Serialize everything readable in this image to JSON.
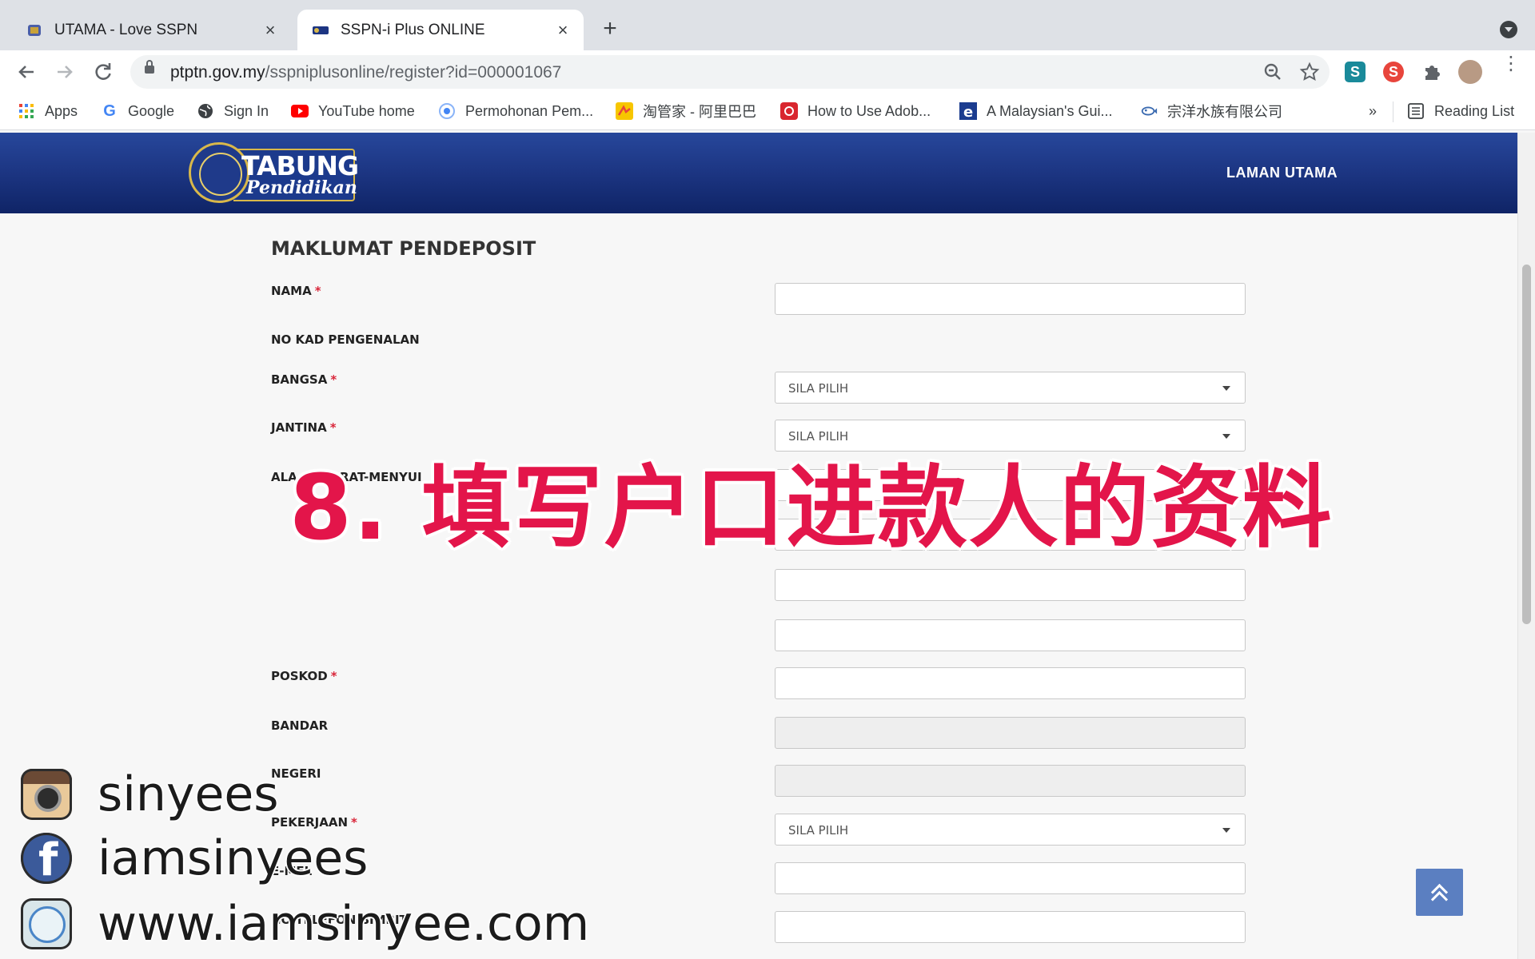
{
  "browser": {
    "tabs": [
      {
        "title": "UTAMA - Love SSPN",
        "active": false
      },
      {
        "title": "SSPN-i Plus ONLINE",
        "active": true
      }
    ],
    "new_tab_label": "+",
    "close_label": "×",
    "url_domain": "ptptn.gov.my",
    "url_path": "/sspniplusonline/register?id=000001067",
    "bookmarks": [
      {
        "label": "Apps"
      },
      {
        "label": "Google"
      },
      {
        "label": "Sign In"
      },
      {
        "label": "YouTube home"
      },
      {
        "label": "Permohonan Pem..."
      },
      {
        "label": "淘管家 - 阿里巴巴"
      },
      {
        "label": "How to Use Adob..."
      },
      {
        "label": "A Malaysian's Gui..."
      },
      {
        "label": "宗洋水族有限公司"
      }
    ],
    "bookmarks_more": "»",
    "reading_list": "Reading List",
    "extensions": [
      {
        "name": "s-extension",
        "letter": "S",
        "color": "#1a8a9a"
      },
      {
        "name": "s-red-extension",
        "letter": "S",
        "color": "#e8453c"
      }
    ]
  },
  "site": {
    "logo_word1": "TABUNG",
    "logo_word2": "Pendidikan",
    "nav_home": "LAMAN UTAMA"
  },
  "form": {
    "section_title": "MAKLUMAT PENDEPOSIT",
    "required_mark": "*",
    "labels": {
      "nama": "NAMA",
      "ic": "NO KAD PENGENALAN",
      "bangsa": "BANGSA",
      "jantina": "JANTINA",
      "alamat": "ALA",
      "alamat_tail": "RAT-MENYUI",
      "poskod": "POSKOD",
      "bandar": "BANDAR",
      "negeri": "NEGERI",
      "pekerjaan": "PEKERJAAN",
      "emel": "E-MEL",
      "telefon": "NO TELEFON BIMBIT"
    },
    "select_placeholder": "SILA PILIH"
  },
  "overlay": {
    "caption": "8. 填写户口进款人的资料",
    "social": [
      {
        "icon": "instagram-icon",
        "text": "sinyees"
      },
      {
        "icon": "facebook-icon",
        "text": "iamsinyees"
      },
      {
        "icon": "safari-icon",
        "text": "www.iamsinyee.com"
      }
    ]
  }
}
